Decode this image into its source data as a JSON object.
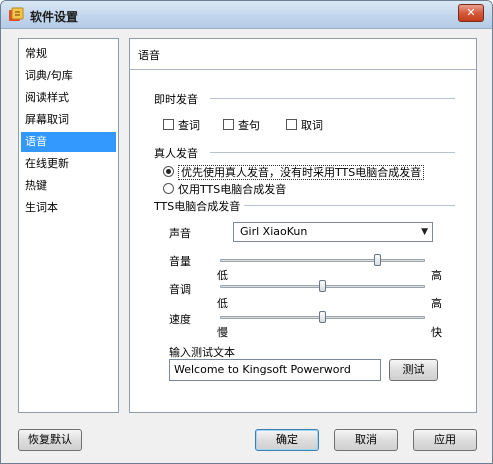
{
  "window": {
    "title": "软件设置",
    "close_label": "✕"
  },
  "nav": {
    "items": [
      "常规",
      "词典/句库",
      "阅读样式",
      "屏幕取词",
      "语音",
      "在线更新",
      "热键",
      "生词本"
    ],
    "active_index": 4
  },
  "panel": {
    "title": "语音",
    "instant": {
      "title": "即时发音",
      "options": [
        "查词",
        "查句",
        "取词"
      ]
    },
    "human": {
      "title": "真人发音",
      "options": [
        "优先使用真人发音，没有时采用TTS电脑合成发音",
        "仅用TTS电脑合成发音"
      ],
      "selected_index": 0
    },
    "tts": {
      "title": "TTS电脑合成发音",
      "voice_label": "声音",
      "voice_value": "Girl XiaoKun",
      "volume_label": "音量",
      "volume_low": "低",
      "volume_high": "高",
      "volume_level": 0.78,
      "pitch_label": "音调",
      "pitch_low": "低",
      "pitch_high": "高",
      "pitch_level": 0.5,
      "speed_label": "速度",
      "speed_low": "慢",
      "speed_high": "快",
      "speed_level": 0.5,
      "test_label": "输入测试文本",
      "test_value": "Welcome to Kingsoft Powerword",
      "test_button": "测试"
    }
  },
  "footer": {
    "restore": "恢复默认",
    "ok": "确定",
    "cancel": "取消",
    "apply": "应用"
  }
}
